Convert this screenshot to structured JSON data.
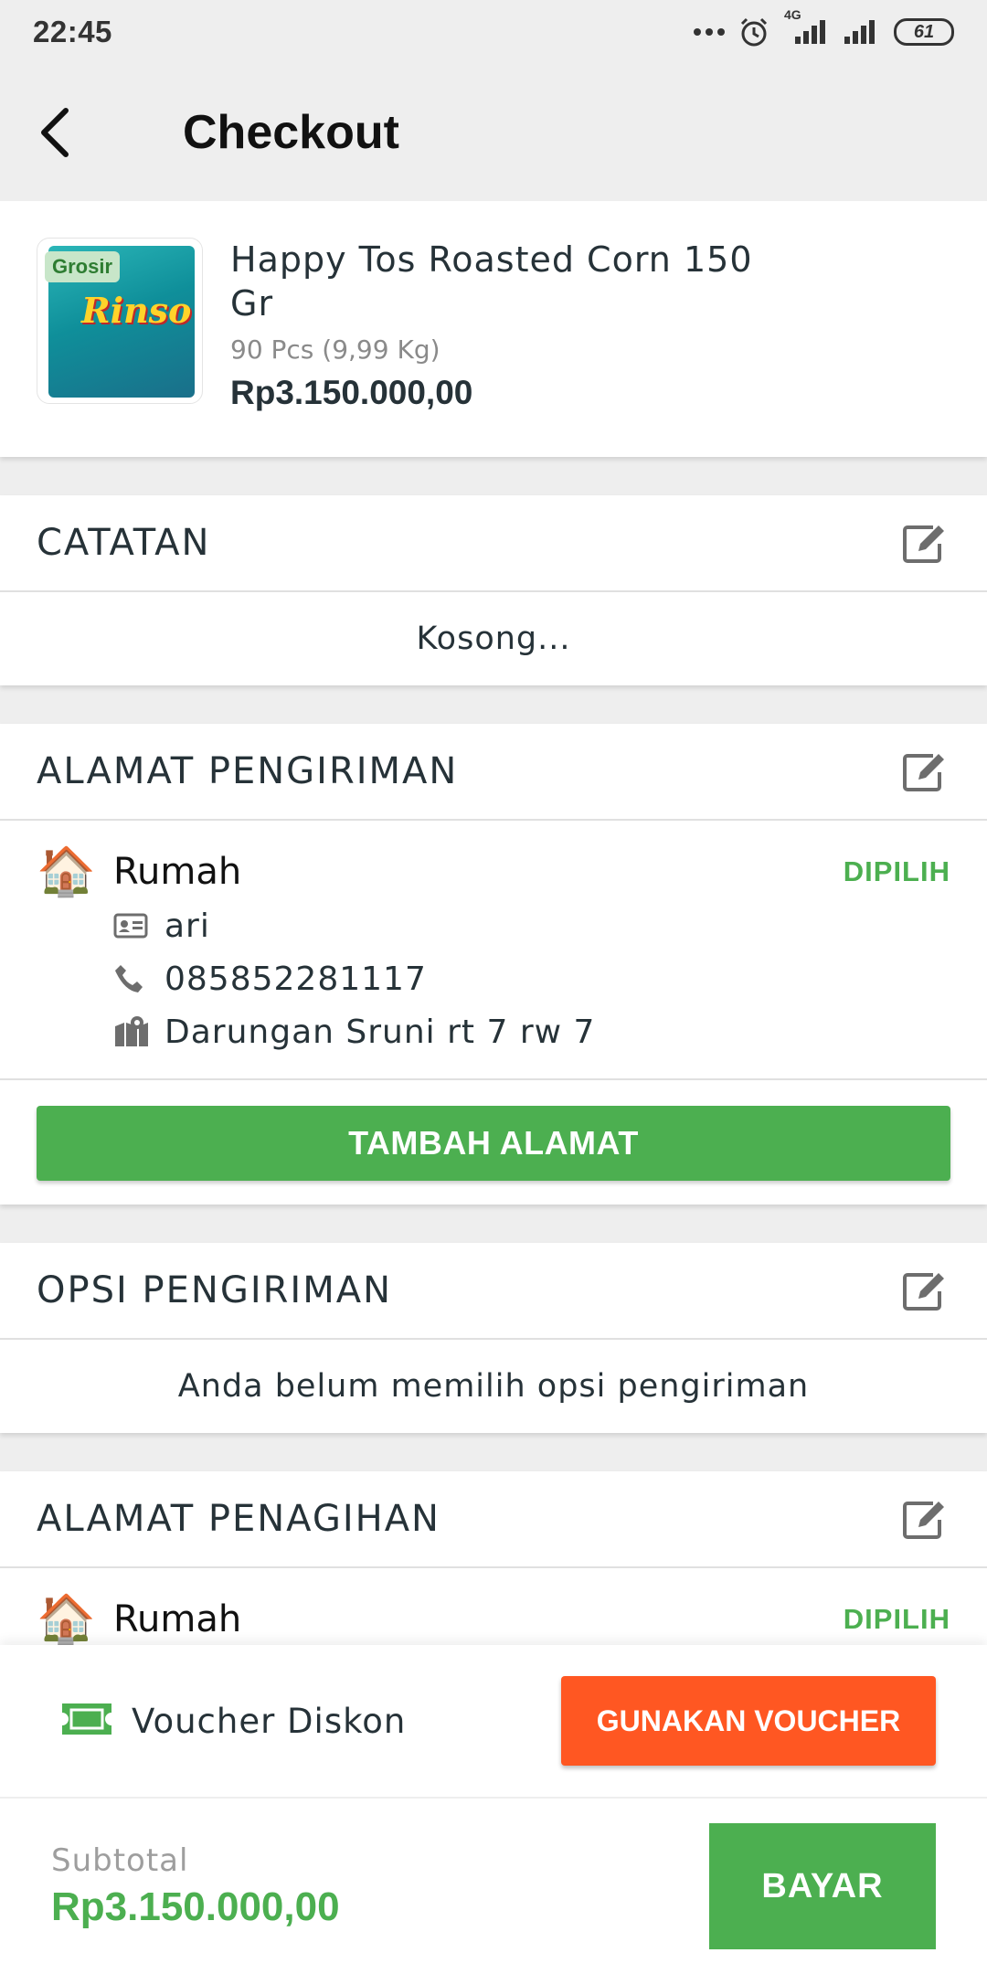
{
  "status_bar": {
    "time": "22:45",
    "network": "4G",
    "battery": "61"
  },
  "header": {
    "title": "Checkout",
    "back_icon": "chevron-left-icon"
  },
  "product": {
    "badge": "Grosir",
    "brand_on_pack": "Rinso",
    "name": "Happy Tos Roasted Corn 150 Gr",
    "quantity": "90 Pcs (9,99 Kg)",
    "price": "Rp3.150.000,00"
  },
  "notes": {
    "title": "CATATAN",
    "content": "Kosong..."
  },
  "shipping_address": {
    "title": "ALAMAT PENGIRIMAN",
    "label": "Rumah",
    "selected": "DIPILIH",
    "recipient": "ari",
    "phone": "085852281117",
    "address": "Darungan Sruni rt 7 rw 7",
    "add_button": "TAMBAH ALAMAT"
  },
  "shipping_option": {
    "title": "OPSI PENGIRIMAN",
    "content": "Anda belum memilih opsi pengiriman"
  },
  "billing_address": {
    "title": "ALAMAT PENAGIHAN",
    "label": "Rumah",
    "selected": "DIPILIH"
  },
  "voucher": {
    "label": "Voucher Diskon",
    "button": "GUNAKAN VOUCHER"
  },
  "footer": {
    "subtotal_label": "Subtotal",
    "subtotal_value": "Rp3.150.000,00",
    "pay_button": "BAYAR"
  },
  "colors": {
    "primary_green": "#4caf50",
    "voucher_orange": "#ff5722",
    "text_dark": "#263238",
    "background": "#eeeeee"
  }
}
